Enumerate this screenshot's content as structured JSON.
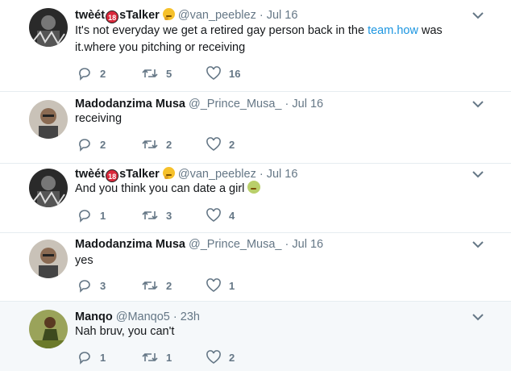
{
  "tweets": [
    {
      "name_prefix": "twèét",
      "badge": "18",
      "name_suffix": "sTalker",
      "handle": "@van_peeblez",
      "dot": "·",
      "time": "Jul 16",
      "text_before_link": "It's not everyday we get a retired gay person back in the ",
      "link": "team.how",
      "text_after_link": " was",
      "text_line2": "it.where you pitching or receiving",
      "replies": "2",
      "retweets": "5",
      "likes": "16"
    },
    {
      "name": "Madodanzima Musa",
      "handle": "@_Prince_Musa_",
      "dot": "·",
      "time": "Jul 16",
      "text": "receiving",
      "replies": "2",
      "retweets": "2",
      "likes": "2"
    },
    {
      "name_prefix": "twèét",
      "badge": "18",
      "name_suffix": "sTalker",
      "handle": "@van_peeblez",
      "dot": "·",
      "time": "Jul 16",
      "text": "And you think you can date a girl",
      "replies": "1",
      "retweets": "3",
      "likes": "4"
    },
    {
      "name": "Madodanzima Musa",
      "handle": "@_Prince_Musa_",
      "dot": "·",
      "time": "Jul 16",
      "text": "yes",
      "replies": "3",
      "retweets": "2",
      "likes": "1"
    },
    {
      "name": "Manqo",
      "handle": "@Manqo5",
      "dot": "·",
      "time": "23h",
      "text": "Nah bruv, you can't",
      "replies": "1",
      "retweets": "1",
      "likes": "2"
    }
  ],
  "colors": {
    "thread_line": "#9ad7ea",
    "link": "#1b95e0",
    "muted": "#657786",
    "highlight_bg": "#f5f8fa"
  },
  "icons": [
    "reply-icon",
    "retweet-icon",
    "like-icon",
    "caret-down-icon",
    "thinking-face-emoji",
    "sick-face-emoji"
  ]
}
